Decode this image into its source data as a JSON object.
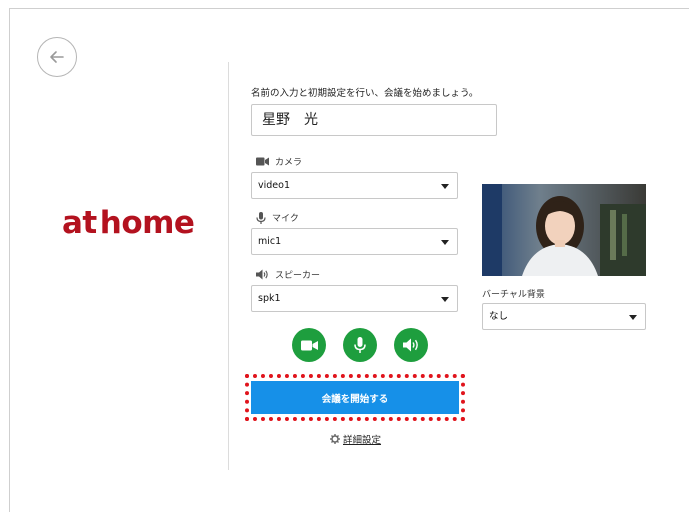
{
  "nav": {
    "back_icon": "arrow-left-icon"
  },
  "brand": {
    "logo_text": "athome",
    "color": "#b3121f"
  },
  "form": {
    "prompt": "名前の入力と初期設定を行い、会議を始めましょう。",
    "name_value": "星野　光"
  },
  "devices": {
    "camera": {
      "label": "カメラ",
      "icon": "camera-icon",
      "selected": "video1"
    },
    "mic": {
      "label": "マイク",
      "icon": "microphone-icon",
      "selected": "mic1"
    },
    "speaker": {
      "label": "スピーカー",
      "icon": "speaker-icon",
      "selected": "spk1"
    }
  },
  "toggles": {
    "camera_icon": "camera-toggle-icon",
    "mic_icon": "mic-toggle-icon",
    "speaker_icon": "speaker-toggle-icon",
    "color": "#1e9e3e"
  },
  "actions": {
    "start_label": "会議を開始する",
    "start_color": "#1690e8",
    "highlight_color": "#e0141c",
    "details_label": "詳細設定",
    "details_icon": "gear-icon"
  },
  "virtual_background": {
    "label": "バーチャル背景",
    "selected": "なし"
  }
}
